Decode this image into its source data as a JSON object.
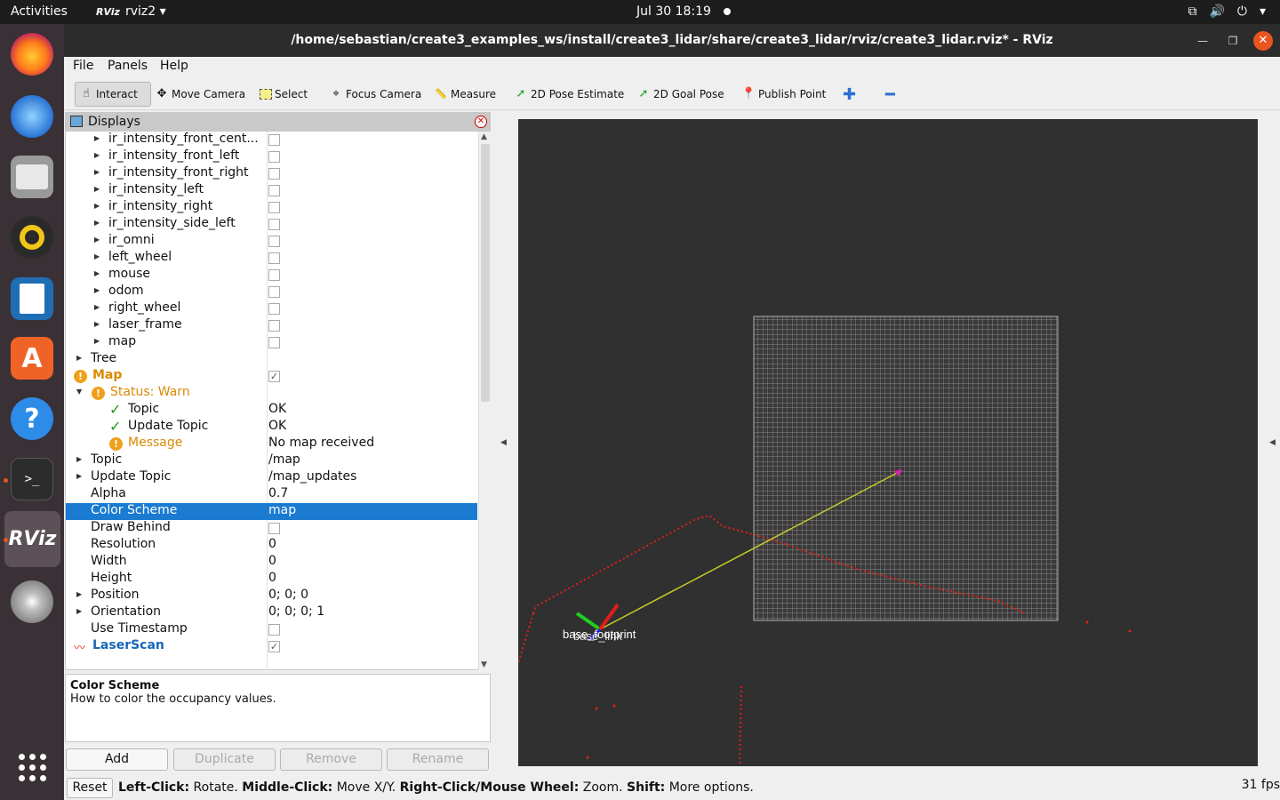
{
  "topbar": {
    "activities": "Activities",
    "app_name": "rviz2",
    "app_icon_text": "RViz",
    "clock": "Jul 30  18:19"
  },
  "window": {
    "title": "/home/sebastian/create3_examples_ws/install/create3_lidar/share/create3_lidar/rviz/create3_lidar.rviz* - RViz"
  },
  "menu": {
    "file": "File",
    "panels": "Panels",
    "help": "Help"
  },
  "toolbar": {
    "interact": "Interact",
    "move_camera": "Move Camera",
    "select": "Select",
    "focus_camera": "Focus Camera",
    "measure": "Measure",
    "pose_estimate": "2D Pose Estimate",
    "goal_pose": "2D Goal Pose",
    "publish_point": "Publish Point"
  },
  "displays": {
    "title": "Displays",
    "rows": [
      {
        "label": "ir_intensity_front_cent...",
        "type": "checkbox",
        "checked": false
      },
      {
        "label": "ir_intensity_front_left",
        "type": "checkbox",
        "checked": false
      },
      {
        "label": "ir_intensity_front_right",
        "type": "checkbox",
        "checked": false
      },
      {
        "label": "ir_intensity_left",
        "type": "checkbox",
        "checked": false
      },
      {
        "label": "ir_intensity_right",
        "type": "checkbox",
        "checked": false
      },
      {
        "label": "ir_intensity_side_left",
        "type": "checkbox",
        "checked": false
      },
      {
        "label": "ir_omni",
        "type": "checkbox",
        "checked": false
      },
      {
        "label": "left_wheel",
        "type": "checkbox",
        "checked": false
      },
      {
        "label": "mouse",
        "type": "checkbox",
        "checked": false
      },
      {
        "label": "odom",
        "type": "checkbox",
        "checked": false
      },
      {
        "label": "right_wheel",
        "type": "checkbox",
        "checked": false
      },
      {
        "label": "laser_frame",
        "type": "checkbox",
        "checked": false
      },
      {
        "label": "map",
        "type": "checkbox",
        "checked": false
      },
      {
        "label": "Tree"
      },
      {
        "label": "Map",
        "type": "checkbox",
        "checked": true
      },
      {
        "label": "Status: Warn"
      },
      {
        "label": "Topic",
        "value": "OK"
      },
      {
        "label": "Update Topic",
        "value": "OK"
      },
      {
        "label": "Message",
        "value": "No map received"
      },
      {
        "label": "Topic",
        "value": "/map"
      },
      {
        "label": "Update Topic",
        "value": "/map_updates"
      },
      {
        "label": "Alpha",
        "value": "0.7"
      },
      {
        "label": "Color Scheme",
        "value": "map"
      },
      {
        "label": "Draw Behind",
        "type": "checkbox",
        "checked": false
      },
      {
        "label": "Resolution",
        "value": "0"
      },
      {
        "label": "Width",
        "value": "0"
      },
      {
        "label": "Height",
        "value": "0"
      },
      {
        "label": "Position",
        "value": "0; 0; 0"
      },
      {
        "label": "Orientation",
        "value": "0; 0; 0; 1"
      },
      {
        "label": "Use Timestamp",
        "type": "checkbox",
        "checked": false
      },
      {
        "label": "LaserScan",
        "type": "checkbox",
        "checked": true
      }
    ]
  },
  "description": {
    "title": "Color Scheme",
    "text": "How to color the occupancy values."
  },
  "buttons": {
    "add": "Add",
    "duplicate": "Duplicate",
    "remove": "Remove",
    "rename": "Rename"
  },
  "viewport": {
    "frame_label": "base_footprint",
    "frame_label2": "base_link",
    "grid_color": "#a0a0a0",
    "scan_color": "#e0201c",
    "line_color": "#c8cc2a"
  },
  "statusbar": {
    "reset": "Reset",
    "left_click_key": "Left-Click:",
    "left_click_desc": " Rotate. ",
    "middle_click_key": "Middle-Click:",
    "middle_click_desc": " Move X/Y. ",
    "right_click_key": "Right-Click/Mouse Wheel:",
    "right_click_desc": " Zoom. ",
    "shift_key": "Shift:",
    "shift_desc": " More options.",
    "fps": "31 fps"
  }
}
